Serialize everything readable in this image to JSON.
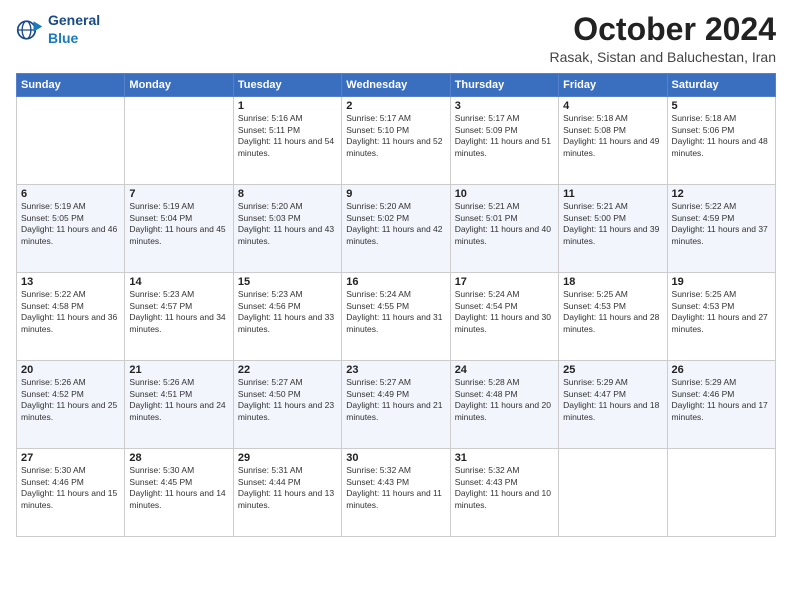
{
  "logo": {
    "general": "General",
    "blue": "Blue"
  },
  "header": {
    "month": "October 2024",
    "location": "Rasak, Sistan and Baluchestan, Iran"
  },
  "weekdays": [
    "Sunday",
    "Monday",
    "Tuesday",
    "Wednesday",
    "Thursday",
    "Friday",
    "Saturday"
  ],
  "weeks": [
    [
      {
        "day": "",
        "sunrise": "",
        "sunset": "",
        "daylight": ""
      },
      {
        "day": "",
        "sunrise": "",
        "sunset": "",
        "daylight": ""
      },
      {
        "day": "1",
        "sunrise": "Sunrise: 5:16 AM",
        "sunset": "Sunset: 5:11 PM",
        "daylight": "Daylight: 11 hours and 54 minutes."
      },
      {
        "day": "2",
        "sunrise": "Sunrise: 5:17 AM",
        "sunset": "Sunset: 5:10 PM",
        "daylight": "Daylight: 11 hours and 52 minutes."
      },
      {
        "day": "3",
        "sunrise": "Sunrise: 5:17 AM",
        "sunset": "Sunset: 5:09 PM",
        "daylight": "Daylight: 11 hours and 51 minutes."
      },
      {
        "day": "4",
        "sunrise": "Sunrise: 5:18 AM",
        "sunset": "Sunset: 5:08 PM",
        "daylight": "Daylight: 11 hours and 49 minutes."
      },
      {
        "day": "5",
        "sunrise": "Sunrise: 5:18 AM",
        "sunset": "Sunset: 5:06 PM",
        "daylight": "Daylight: 11 hours and 48 minutes."
      }
    ],
    [
      {
        "day": "6",
        "sunrise": "Sunrise: 5:19 AM",
        "sunset": "Sunset: 5:05 PM",
        "daylight": "Daylight: 11 hours and 46 minutes."
      },
      {
        "day": "7",
        "sunrise": "Sunrise: 5:19 AM",
        "sunset": "Sunset: 5:04 PM",
        "daylight": "Daylight: 11 hours and 45 minutes."
      },
      {
        "day": "8",
        "sunrise": "Sunrise: 5:20 AM",
        "sunset": "Sunset: 5:03 PM",
        "daylight": "Daylight: 11 hours and 43 minutes."
      },
      {
        "day": "9",
        "sunrise": "Sunrise: 5:20 AM",
        "sunset": "Sunset: 5:02 PM",
        "daylight": "Daylight: 11 hours and 42 minutes."
      },
      {
        "day": "10",
        "sunrise": "Sunrise: 5:21 AM",
        "sunset": "Sunset: 5:01 PM",
        "daylight": "Daylight: 11 hours and 40 minutes."
      },
      {
        "day": "11",
        "sunrise": "Sunrise: 5:21 AM",
        "sunset": "Sunset: 5:00 PM",
        "daylight": "Daylight: 11 hours and 39 minutes."
      },
      {
        "day": "12",
        "sunrise": "Sunrise: 5:22 AM",
        "sunset": "Sunset: 4:59 PM",
        "daylight": "Daylight: 11 hours and 37 minutes."
      }
    ],
    [
      {
        "day": "13",
        "sunrise": "Sunrise: 5:22 AM",
        "sunset": "Sunset: 4:58 PM",
        "daylight": "Daylight: 11 hours and 36 minutes."
      },
      {
        "day": "14",
        "sunrise": "Sunrise: 5:23 AM",
        "sunset": "Sunset: 4:57 PM",
        "daylight": "Daylight: 11 hours and 34 minutes."
      },
      {
        "day": "15",
        "sunrise": "Sunrise: 5:23 AM",
        "sunset": "Sunset: 4:56 PM",
        "daylight": "Daylight: 11 hours and 33 minutes."
      },
      {
        "day": "16",
        "sunrise": "Sunrise: 5:24 AM",
        "sunset": "Sunset: 4:55 PM",
        "daylight": "Daylight: 11 hours and 31 minutes."
      },
      {
        "day": "17",
        "sunrise": "Sunrise: 5:24 AM",
        "sunset": "Sunset: 4:54 PM",
        "daylight": "Daylight: 11 hours and 30 minutes."
      },
      {
        "day": "18",
        "sunrise": "Sunrise: 5:25 AM",
        "sunset": "Sunset: 4:53 PM",
        "daylight": "Daylight: 11 hours and 28 minutes."
      },
      {
        "day": "19",
        "sunrise": "Sunrise: 5:25 AM",
        "sunset": "Sunset: 4:53 PM",
        "daylight": "Daylight: 11 hours and 27 minutes."
      }
    ],
    [
      {
        "day": "20",
        "sunrise": "Sunrise: 5:26 AM",
        "sunset": "Sunset: 4:52 PM",
        "daylight": "Daylight: 11 hours and 25 minutes."
      },
      {
        "day": "21",
        "sunrise": "Sunrise: 5:26 AM",
        "sunset": "Sunset: 4:51 PM",
        "daylight": "Daylight: 11 hours and 24 minutes."
      },
      {
        "day": "22",
        "sunrise": "Sunrise: 5:27 AM",
        "sunset": "Sunset: 4:50 PM",
        "daylight": "Daylight: 11 hours and 23 minutes."
      },
      {
        "day": "23",
        "sunrise": "Sunrise: 5:27 AM",
        "sunset": "Sunset: 4:49 PM",
        "daylight": "Daylight: 11 hours and 21 minutes."
      },
      {
        "day": "24",
        "sunrise": "Sunrise: 5:28 AM",
        "sunset": "Sunset: 4:48 PM",
        "daylight": "Daylight: 11 hours and 20 minutes."
      },
      {
        "day": "25",
        "sunrise": "Sunrise: 5:29 AM",
        "sunset": "Sunset: 4:47 PM",
        "daylight": "Daylight: 11 hours and 18 minutes."
      },
      {
        "day": "26",
        "sunrise": "Sunrise: 5:29 AM",
        "sunset": "Sunset: 4:46 PM",
        "daylight": "Daylight: 11 hours and 17 minutes."
      }
    ],
    [
      {
        "day": "27",
        "sunrise": "Sunrise: 5:30 AM",
        "sunset": "Sunset: 4:46 PM",
        "daylight": "Daylight: 11 hours and 15 minutes."
      },
      {
        "day": "28",
        "sunrise": "Sunrise: 5:30 AM",
        "sunset": "Sunset: 4:45 PM",
        "daylight": "Daylight: 11 hours and 14 minutes."
      },
      {
        "day": "29",
        "sunrise": "Sunrise: 5:31 AM",
        "sunset": "Sunset: 4:44 PM",
        "daylight": "Daylight: 11 hours and 13 minutes."
      },
      {
        "day": "30",
        "sunrise": "Sunrise: 5:32 AM",
        "sunset": "Sunset: 4:43 PM",
        "daylight": "Daylight: 11 hours and 11 minutes."
      },
      {
        "day": "31",
        "sunrise": "Sunrise: 5:32 AM",
        "sunset": "Sunset: 4:43 PM",
        "daylight": "Daylight: 11 hours and 10 minutes."
      },
      {
        "day": "",
        "sunrise": "",
        "sunset": "",
        "daylight": ""
      },
      {
        "day": "",
        "sunrise": "",
        "sunset": "",
        "daylight": ""
      }
    ]
  ]
}
